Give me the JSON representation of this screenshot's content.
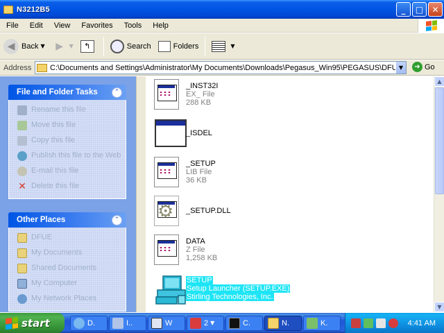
{
  "window": {
    "title": "N3212B5"
  },
  "menu": [
    "File",
    "Edit",
    "View",
    "Favorites",
    "Tools",
    "Help"
  ],
  "toolbar": {
    "back": "Back",
    "search": "Search",
    "folders": "Folders"
  },
  "address": {
    "label": "Address",
    "path": "C:\\Documents and Settings\\Administrator\\My Documents\\Downloads\\Pegasus_Win95\\PEGASUS\\DFUE\\N",
    "go": "Go"
  },
  "tasks": {
    "title": "File and Folder Tasks",
    "items": [
      {
        "label": "Rename this file",
        "icon": "rename-icon"
      },
      {
        "label": "Move this file",
        "icon": "move-icon"
      },
      {
        "label": "Copy this file",
        "icon": "copy-icon"
      },
      {
        "label": "Publish this file to the Web",
        "icon": "publish-icon"
      },
      {
        "label": "E-mail this file",
        "icon": "email-icon"
      },
      {
        "label": "Delete this file",
        "icon": "delete-icon"
      }
    ]
  },
  "other_places": {
    "title": "Other Places",
    "items": [
      {
        "label": "DFUE",
        "icon": "folder-icon"
      },
      {
        "label": "My Documents",
        "icon": "folder-icon"
      },
      {
        "label": "Shared Documents",
        "icon": "folder-icon"
      },
      {
        "label": "My Computer",
        "icon": "computer-icon"
      },
      {
        "label": "My Network Places",
        "icon": "network-icon"
      }
    ]
  },
  "files": [
    {
      "name": "_INST32I",
      "type": "EX_ File",
      "size": "288 KB",
      "icon": "document-icon"
    },
    {
      "name": "_ISDEL",
      "type": "",
      "size": "",
      "icon": "application-icon"
    },
    {
      "name": "_SETUP",
      "type": "LIB File",
      "size": "36 KB",
      "icon": "document-icon"
    },
    {
      "name": "_SETUP.DLL",
      "type": "",
      "size": "",
      "icon": "dll-icon"
    },
    {
      "name": "DATA",
      "type": "Z File",
      "size": "1,258 KB",
      "icon": "document-icon"
    },
    {
      "name": "SETUP",
      "type": "Setup Launcher (SETUP.EXE)",
      "size": "Stirling Technologies, Inc.",
      "icon": "setup-icon",
      "selected": true
    }
  ],
  "taskbar": {
    "start": "start",
    "buttons": [
      "D.",
      "I..",
      "W",
      "2",
      "C.",
      "N.",
      "K."
    ],
    "active_index": 5,
    "clock": "4:41 AM"
  },
  "colors": {
    "title_blue": "#0054e3",
    "panel_blue": "#7ba1e6",
    "selection_cyan": "#1ee5f5",
    "start_green": "#3c9a3c"
  }
}
